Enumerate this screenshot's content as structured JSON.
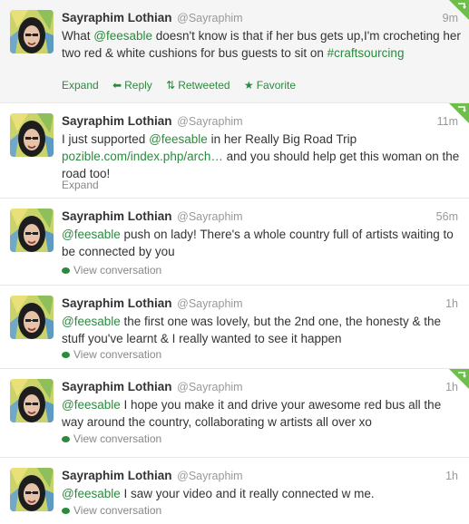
{
  "colors": {
    "accent": "#2b8a3e",
    "meta": "#999999",
    "text": "#333333",
    "hover_bg": "#f5f5f5"
  },
  "tweets": [
    {
      "name": "Sayraphim Lothian",
      "handle": "@Sayraphim",
      "time": "9m",
      "segments": [
        {
          "t": "What "
        },
        {
          "t": "@feesable",
          "k": "mention"
        },
        {
          "t": " doesn't know is that if her bus gets up,I'm crocheting her two red & white cushions for bus guests to sit on "
        },
        {
          "t": "#craftsourcing",
          "k": "hashtag"
        }
      ],
      "actions": {
        "expand": "Expand",
        "reply": "Reply",
        "retweeted": "Retweeted",
        "favorite": "Favorite"
      },
      "retweet_badge": true
    },
    {
      "name": "Sayraphim Lothian",
      "handle": "@Sayraphim",
      "time": "11m",
      "segments": [
        {
          "t": "I just supported "
        },
        {
          "t": "@feesable",
          "k": "mention"
        },
        {
          "t": " in her Really Big Road Trip "
        },
        {
          "t": "pozible.com/index.php/arch…",
          "k": "link"
        },
        {
          "t": " and you should help get this woman on the road too!"
        }
      ],
      "actions": {
        "expand": "Expand"
      },
      "retweet_badge": true
    },
    {
      "name": "Sayraphim Lothian",
      "handle": "@Sayraphim",
      "time": "56m",
      "segments": [
        {
          "t": "@feesable",
          "k": "mention"
        },
        {
          "t": " push on lady! There's a whole country full of artists waiting to be connected by you"
        }
      ],
      "actions": {
        "conversation": "View conversation"
      },
      "retweet_badge": false
    },
    {
      "name": "Sayraphim Lothian",
      "handle": "@Sayraphim",
      "time": "1h",
      "segments": [
        {
          "t": "@feesable",
          "k": "mention"
        },
        {
          "t": " the first one was lovely, but the 2nd one, the honesty & the stuff you've learnt & I really wanted to see it happen"
        }
      ],
      "actions": {
        "conversation": "View conversation"
      },
      "retweet_badge": false
    },
    {
      "name": "Sayraphim Lothian",
      "handle": "@Sayraphim",
      "time": "1h",
      "segments": [
        {
          "t": "@feesable",
          "k": "mention"
        },
        {
          "t": " I hope you make it and drive your awesome red bus all the way around the country, collaborating w artists all over xo"
        }
      ],
      "actions": {
        "conversation": "View conversation"
      },
      "retweet_badge": true
    },
    {
      "name": "Sayraphim Lothian",
      "handle": "@Sayraphim",
      "time": "1h",
      "segments": [
        {
          "t": "@feesable",
          "k": "mention"
        },
        {
          "t": " I saw your video and it really connected w me."
        }
      ],
      "actions": {
        "conversation": "View conversation"
      },
      "retweet_badge": false
    }
  ]
}
